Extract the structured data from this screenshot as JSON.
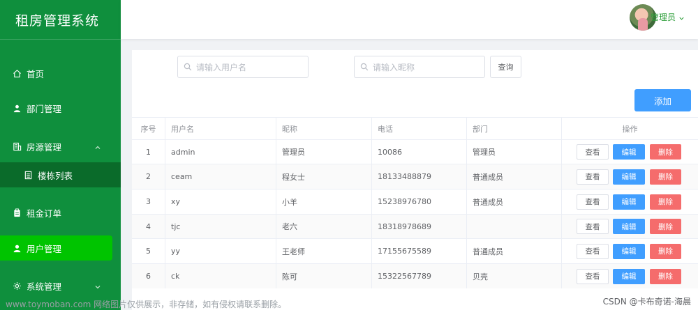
{
  "app": {
    "title": "租房管理系统"
  },
  "sidebar": {
    "items": [
      {
        "label": "首页",
        "icon": "home-icon"
      },
      {
        "label": "部门管理",
        "icon": "user-icon"
      },
      {
        "label": "房源管理",
        "icon": "building-icon"
      },
      {
        "label": "楼栋列表",
        "icon": "document-icon"
      },
      {
        "label": "租金订单",
        "icon": "clipboard-icon"
      },
      {
        "label": "用户管理",
        "icon": "user-icon"
      },
      {
        "label": "系统管理",
        "icon": "gear-icon"
      }
    ]
  },
  "header": {
    "user_name": "管理员"
  },
  "search": {
    "username_placeholder": "请输入用户名",
    "nickname_placeholder": "请输入昵称",
    "query_label": "查询"
  },
  "toolbar": {
    "add_label": "添加"
  },
  "table": {
    "headers": [
      "序号",
      "用户名",
      "昵称",
      "电话",
      "部门",
      "操作"
    ],
    "rows": [
      {
        "index": "1",
        "username": "admin",
        "nickname": "管理员",
        "phone": "10086",
        "dept": "管理员"
      },
      {
        "index": "2",
        "username": "ceam",
        "nickname": "程女士",
        "phone": "18133488879",
        "dept": "普通成员"
      },
      {
        "index": "3",
        "username": "xy",
        "nickname": "小羊",
        "phone": "15238976780",
        "dept": "普通成员"
      },
      {
        "index": "4",
        "username": "tjc",
        "nickname": "老六",
        "phone": "18318978689",
        "dept": ""
      },
      {
        "index": "5",
        "username": "yy",
        "nickname": "王老师",
        "phone": "17155675589",
        "dept": "普通成员"
      },
      {
        "index": "6",
        "username": "ck",
        "nickname": "陈可",
        "phone": "15322567789",
        "dept": "贝壳"
      }
    ],
    "actions": {
      "view": "查看",
      "edit": "编辑",
      "delete": "删除"
    }
  },
  "footer": {
    "watermark": "www.toymoban.com 网络图片仅供展示，非存储，如有侵权请联系删除。",
    "credit": "CSDN @卡布奇诺-海晨"
  },
  "colors": {
    "sidebar_bg": "#0f8f3d",
    "active_item": "#00c400",
    "primary": "#409eff",
    "danger": "#f56c6c"
  }
}
